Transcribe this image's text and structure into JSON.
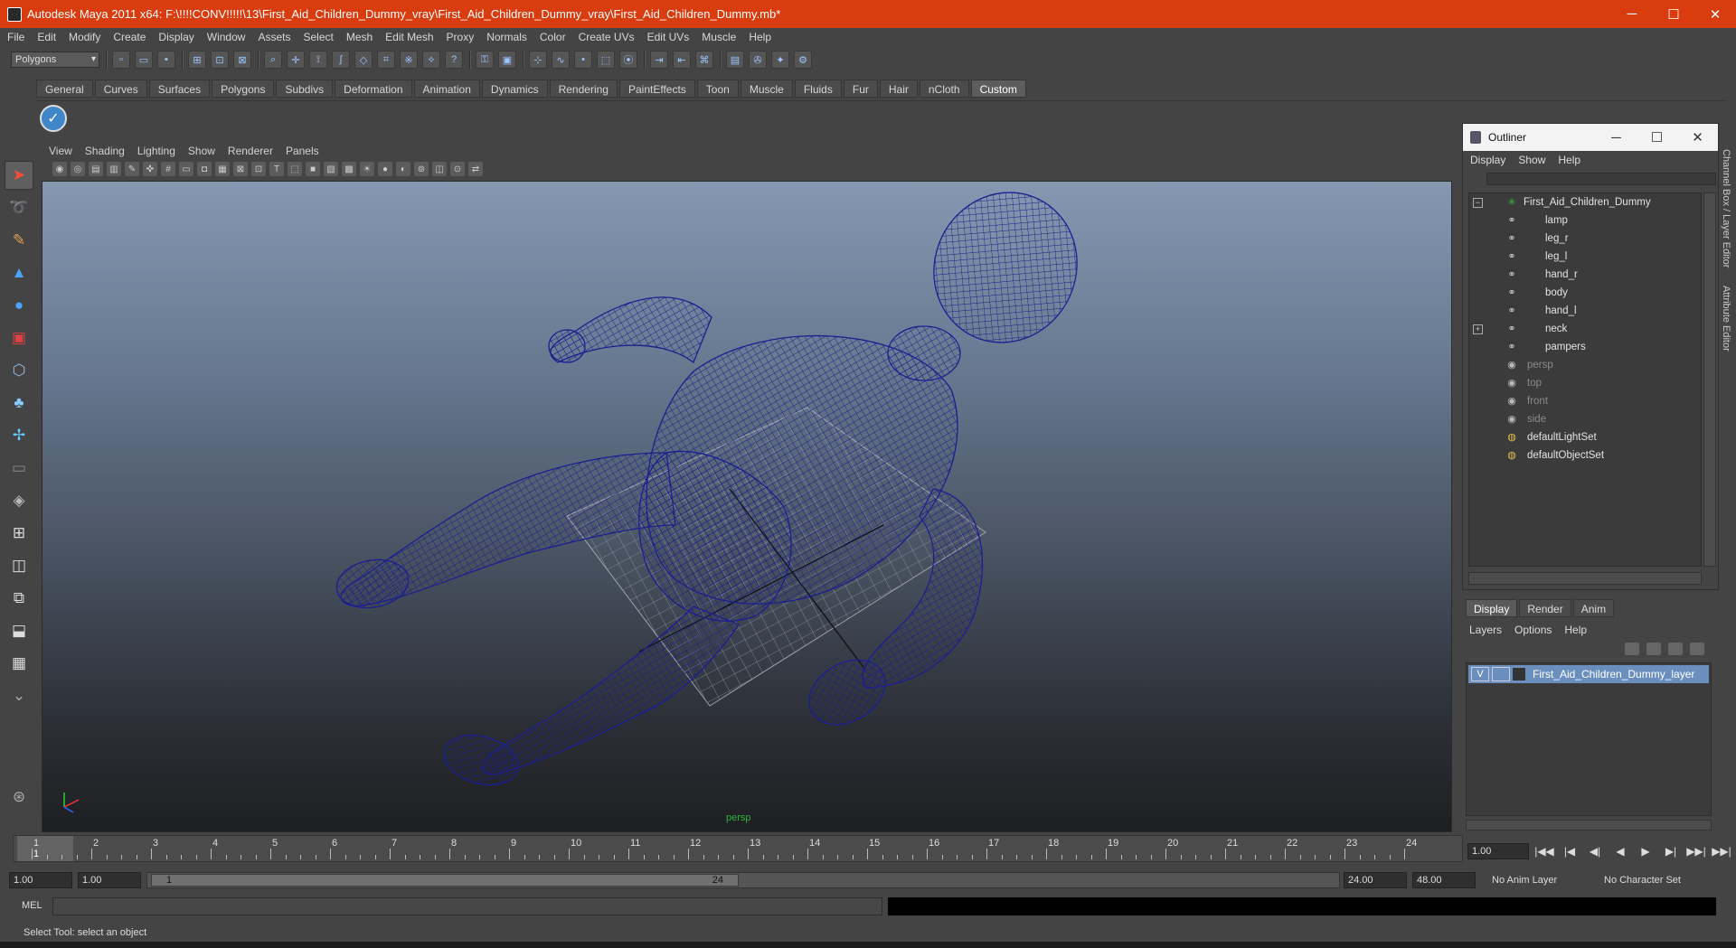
{
  "window": {
    "title": "Autodesk Maya 2011 x64: F:\\!!!!CONV!!!!!\\13\\First_Aid_Children_Dummy_vray\\First_Aid_Children_Dummy_vray\\First_Aid_Children_Dummy.mb*",
    "minimize": "─",
    "maximize": "☐",
    "close": "✕"
  },
  "menubar": [
    "File",
    "Edit",
    "Modify",
    "Create",
    "Display",
    "Window",
    "Assets",
    "Select",
    "Mesh",
    "Edit Mesh",
    "Proxy",
    "Normals",
    "Color",
    "Create UVs",
    "Edit UVs",
    "Muscle",
    "Help"
  ],
  "statusline": {
    "mode": "Polygons"
  },
  "shelf": {
    "tabs": [
      "General",
      "Curves",
      "Surfaces",
      "Polygons",
      "Subdivs",
      "Deformation",
      "Animation",
      "Dynamics",
      "Rendering",
      "PaintEffects",
      "Toon",
      "Muscle",
      "Fluids",
      "Fur",
      "Hair",
      "nCloth",
      "Custom"
    ],
    "active_tab": "Custom"
  },
  "viewport": {
    "menu": [
      "View",
      "Shading",
      "Lighting",
      "Show",
      "Renderer",
      "Panels"
    ],
    "camera": "persp"
  },
  "outliner": {
    "title": "Outliner",
    "menu": [
      "Display",
      "Show",
      "Help"
    ],
    "items": [
      {
        "label": "First_Aid_Children_Dummy",
        "level": 0,
        "dim": false
      },
      {
        "label": "lamp",
        "level": 1,
        "dim": false
      },
      {
        "label": "leg_r",
        "level": 1,
        "dim": false
      },
      {
        "label": "leg_l",
        "level": 1,
        "dim": false
      },
      {
        "label": "hand_r",
        "level": 1,
        "dim": false
      },
      {
        "label": "body",
        "level": 1,
        "dim": false
      },
      {
        "label": "hand_l",
        "level": 1,
        "dim": false
      },
      {
        "label": "neck",
        "level": 1,
        "dim": false
      },
      {
        "label": "pampers",
        "level": 1,
        "dim": false
      },
      {
        "label": "persp",
        "level": 0,
        "dim": true
      },
      {
        "label": "top",
        "level": 0,
        "dim": true
      },
      {
        "label": "front",
        "level": 0,
        "dim": true
      },
      {
        "label": "side",
        "level": 0,
        "dim": true
      },
      {
        "label": "defaultLightSet",
        "level": 0,
        "dim": false
      },
      {
        "label": "defaultObjectSet",
        "level": 0,
        "dim": false
      }
    ]
  },
  "layer_editor": {
    "tabs": [
      "Display",
      "Render",
      "Anim"
    ],
    "menu": [
      "Layers",
      "Options",
      "Help"
    ],
    "layer": {
      "visible": "V",
      "name": "First_Aid_Children_Dummy_layer"
    }
  },
  "side_tabs": [
    "Channel Box / Layer Editor",
    "Attribute Editor"
  ],
  "timeslider": {
    "ticks": [
      "1",
      "2",
      "3",
      "4",
      "5",
      "6",
      "7",
      "8",
      "9",
      "10",
      "11",
      "12",
      "13",
      "14",
      "15",
      "16",
      "17",
      "18",
      "19",
      "20",
      "21",
      "22",
      "23",
      "24"
    ],
    "current_frame": "1",
    "current_time": "1.00"
  },
  "playback": [
    "|◀◀",
    "|◀",
    "◀|",
    "◀",
    "▶",
    "▶|",
    "▶▶|",
    "▶▶|"
  ],
  "range": {
    "start": "1.00",
    "playback_start": "1.00",
    "handle_start": "1",
    "handle_end": "24",
    "playback_end": "24.00",
    "end": "48.00",
    "anim_layer": "No Anim Layer",
    "character_set": "No Character Set"
  },
  "cmdline": {
    "label": "MEL"
  },
  "helpline": "Select Tool: select an object"
}
